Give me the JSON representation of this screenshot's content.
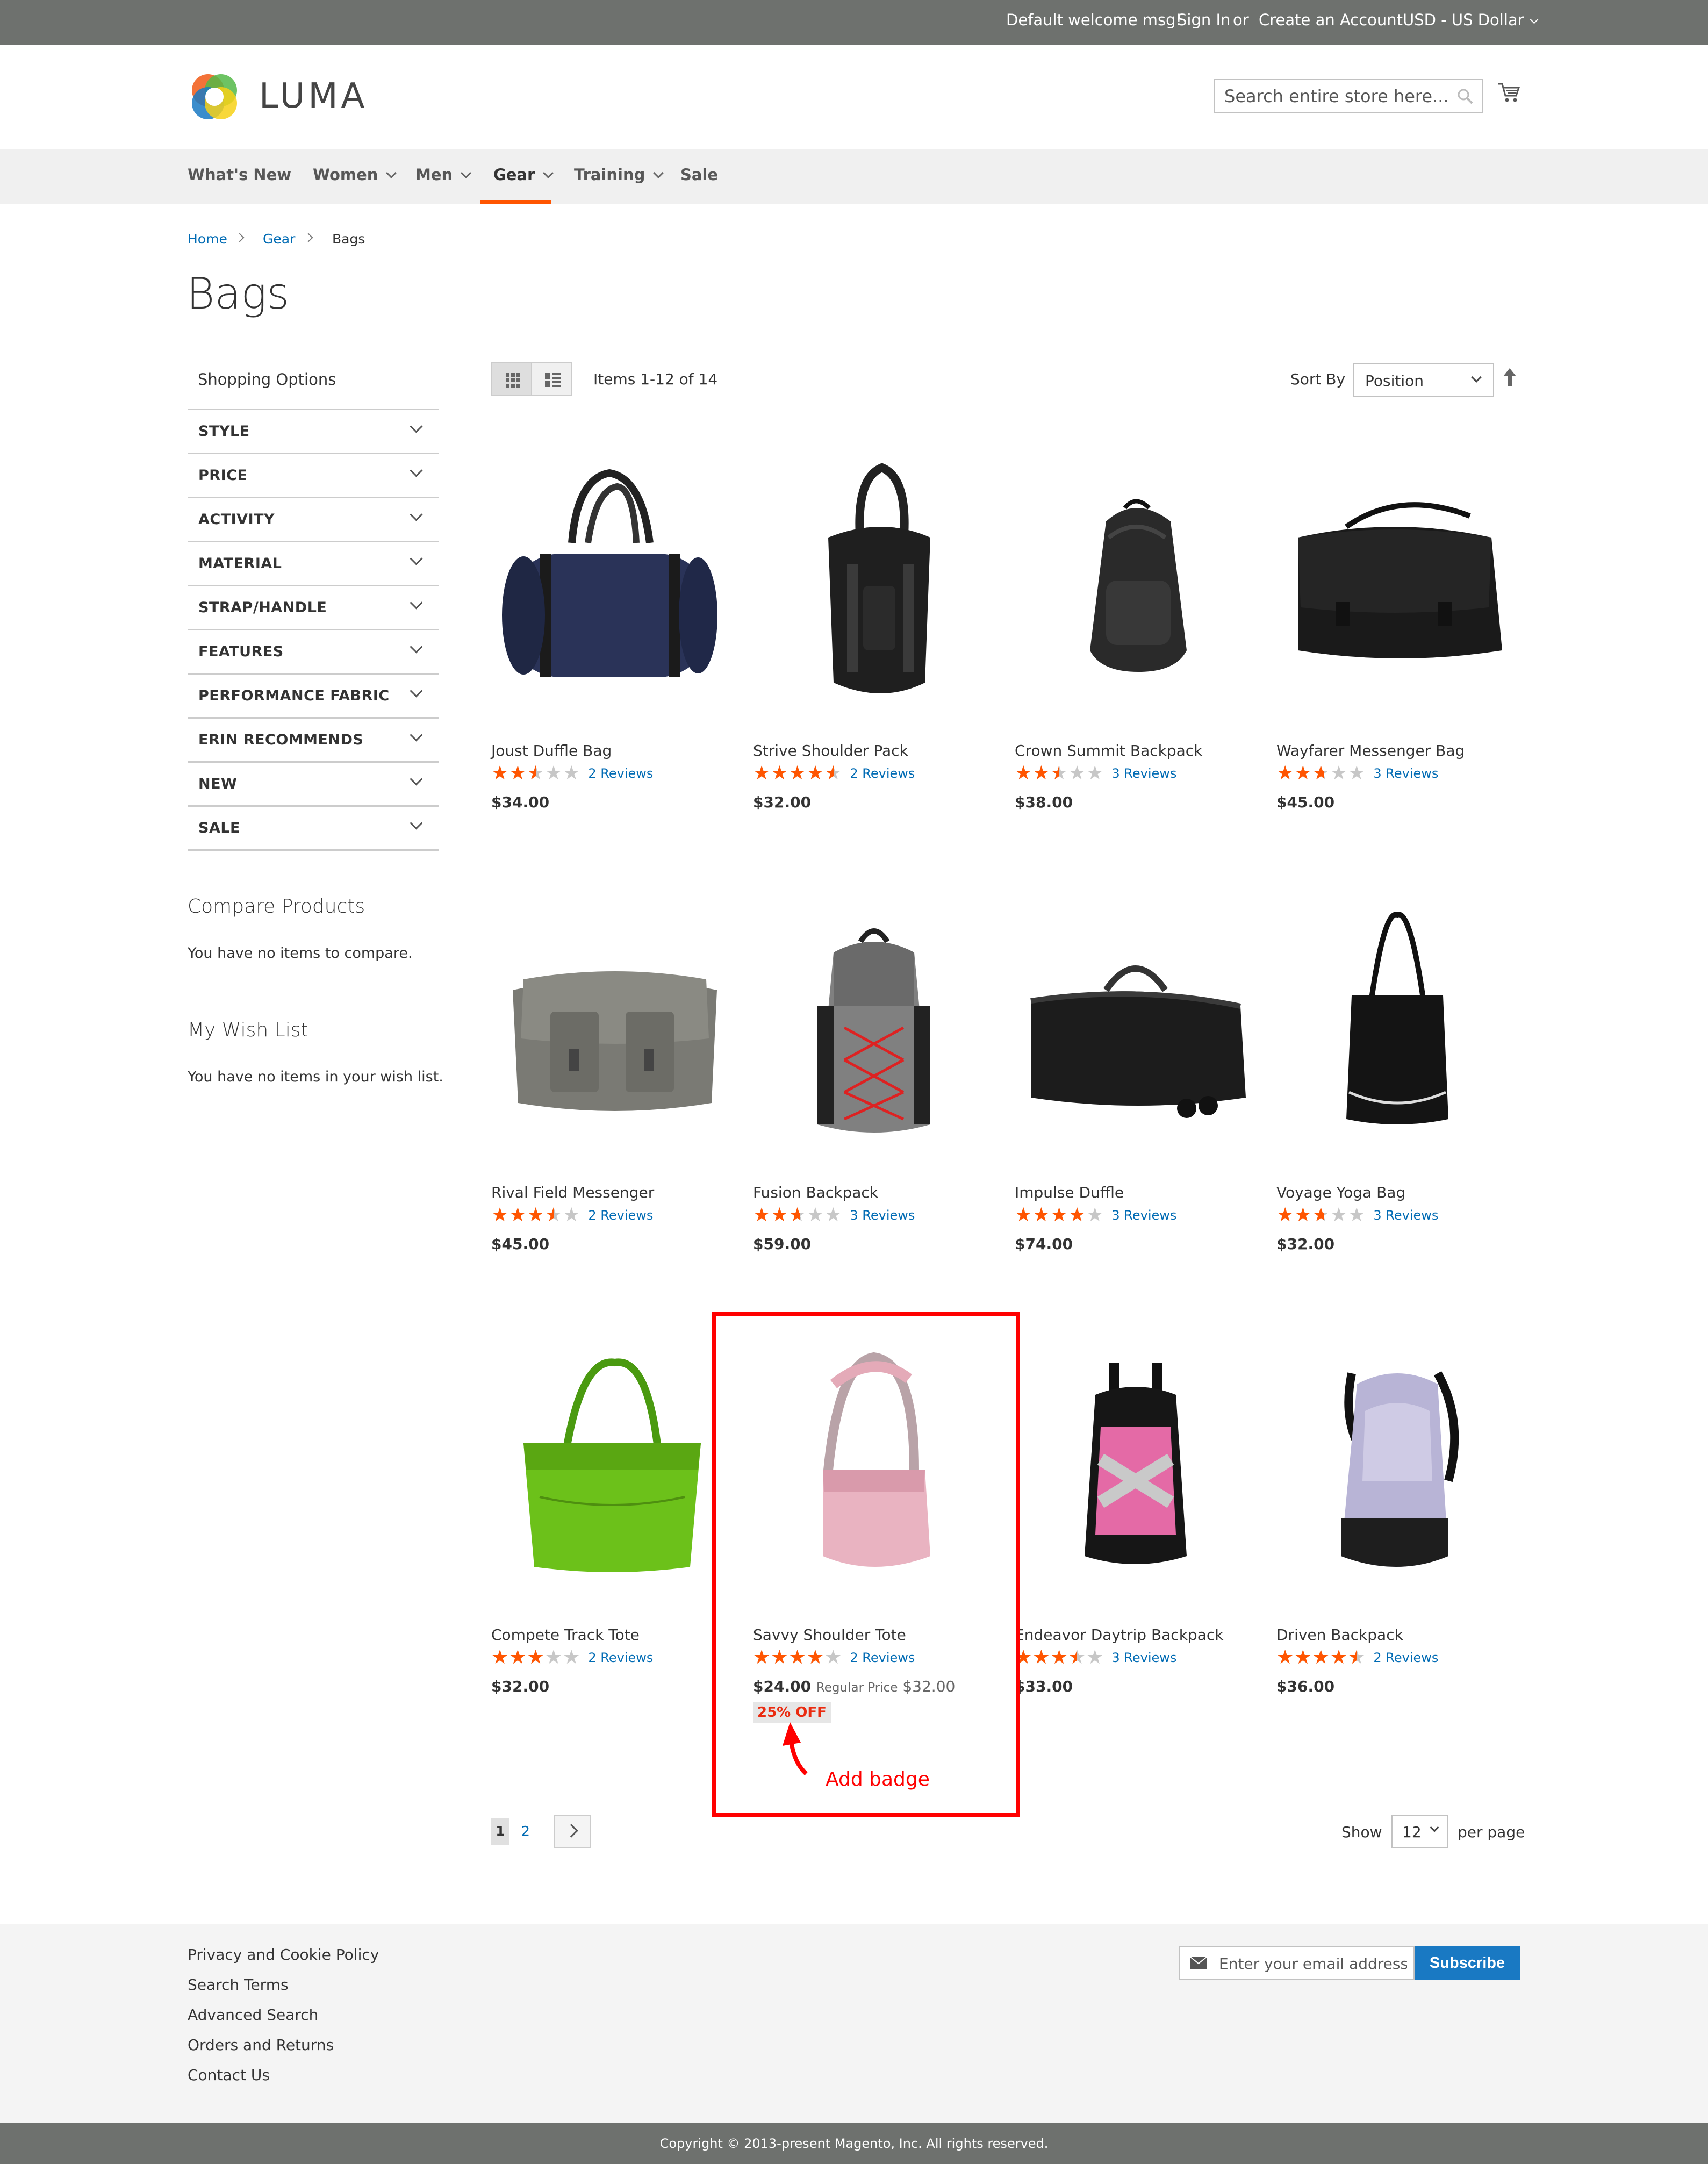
{
  "topbar": {
    "welcome": "Default welcome msg!",
    "sign_in": "Sign In",
    "or": "or",
    "create_account": "Create an Account",
    "currency": "USD - US Dollar"
  },
  "header": {
    "logo_text": "LUMA",
    "search_placeholder": "Search entire store here..."
  },
  "nav": {
    "items": [
      {
        "label": "What's New"
      },
      {
        "label": "Women"
      },
      {
        "label": "Men"
      },
      {
        "label": "Gear"
      },
      {
        "label": "Training"
      },
      {
        "label": "Sale"
      }
    ],
    "active": "Gear"
  },
  "breadcrumb": [
    "Home",
    "Gear",
    "Bags"
  ],
  "page_title": "Bags",
  "sidebar": {
    "shopping_options": "Shopping Options",
    "filters": [
      "STYLE",
      "PRICE",
      "ACTIVITY",
      "MATERIAL",
      "STRAP/HANDLE",
      "FEATURES",
      "PERFORMANCE FABRIC",
      "ERIN RECOMMENDS",
      "NEW",
      "SALE"
    ],
    "compare_title": "Compare Products",
    "compare_text": "You have no items to compare.",
    "wishlist_title": "My Wish List",
    "wishlist_text": "You have no items in your wish list."
  },
  "toolbar": {
    "items_text": "Items 1-12 of 14",
    "sort_label": "Sort By",
    "sort_value": "Position"
  },
  "products": [
    {
      "name": "Joust Duffle Bag",
      "rating_pct": 50,
      "reviews": "2  Reviews",
      "price": "$34.00",
      "icon": "duffle-bag-navy"
    },
    {
      "name": "Strive Shoulder Pack",
      "rating_pct": 90,
      "reviews": "2  Reviews",
      "price": "$32.00",
      "icon": "sling-pack-black"
    },
    {
      "name": "Crown Summit Backpack",
      "rating_pct": 50,
      "reviews": "3  Reviews",
      "price": "$38.00",
      "icon": "backpack-black"
    },
    {
      "name": "Wayfarer Messenger Bag",
      "rating_pct": 53,
      "reviews": "3  Reviews",
      "price": "$45.00",
      "icon": "messenger-black"
    },
    {
      "name": "Rival Field Messenger",
      "rating_pct": 70,
      "reviews": "2  Reviews",
      "price": "$45.00",
      "icon": "messenger-grey"
    },
    {
      "name": "Fusion Backpack",
      "rating_pct": 53,
      "reviews": "3  Reviews",
      "price": "$59.00",
      "icon": "backpack-grey-red"
    },
    {
      "name": "Impulse Duffle",
      "rating_pct": 80,
      "reviews": "3  Reviews",
      "price": "$74.00",
      "icon": "rolling-duffle-black"
    },
    {
      "name": "Voyage Yoga Bag",
      "rating_pct": 53,
      "reviews": "3  Reviews",
      "price": "$32.00",
      "icon": "tote-black"
    },
    {
      "name": "Compete Track Tote",
      "rating_pct": 60,
      "reviews": "2  Reviews",
      "price": "$32.00",
      "icon": "tote-green"
    },
    {
      "name": "Savvy Shoulder Tote",
      "rating_pct": 80,
      "reviews": "2  Reviews",
      "price": "$24.00",
      "regular_label": "Regular Price",
      "regular_price": "$32.00",
      "badge": "25% OFF",
      "icon": "shoulder-bag-pink"
    },
    {
      "name": "Endeavor Daytrip Backpack",
      "rating_pct": 70,
      "reviews": "3  Reviews",
      "price": "$33.00",
      "icon": "backpack-pink"
    },
    {
      "name": "Driven Backpack",
      "rating_pct": 90,
      "reviews": "2  Reviews",
      "price": "$36.00",
      "icon": "backpack-lavender"
    }
  ],
  "annotation": "Add badge",
  "pager": {
    "current": "1",
    "next_page": "2",
    "show_label": "Show",
    "limit": "12",
    "per_page_label": "per page"
  },
  "footer": {
    "links": [
      "Privacy and Cookie Policy",
      "Search Terms",
      "Advanced Search",
      "Orders and Returns",
      "Contact Us"
    ],
    "newsletter_placeholder": "Enter your email address",
    "subscribe_label": "Subscribe",
    "copyright": "Copyright © 2013-present Magento, Inc. All rights reserved."
  },
  "colors": {
    "accent": "#ff5501",
    "link": "#006bb4",
    "primary_button": "#1979c3",
    "annotation_red": "#ff0000",
    "topbar": "#6e716e"
  }
}
